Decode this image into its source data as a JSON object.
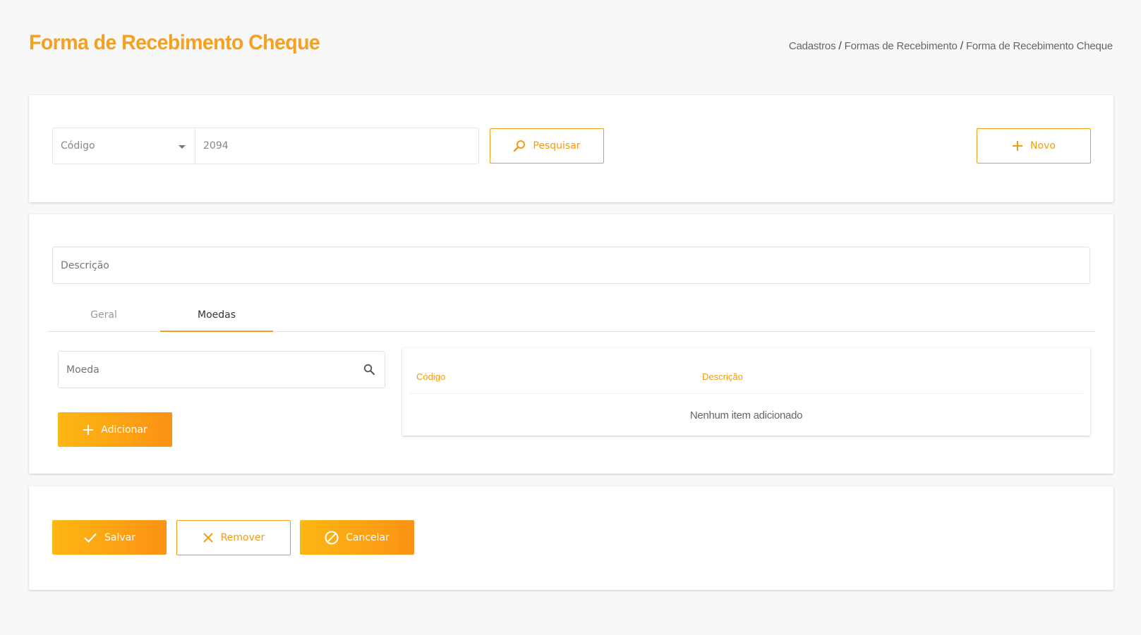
{
  "header": {
    "title": "Forma de Recebimento Cheque",
    "breadcrumb": [
      "Cadastros",
      "Formas de Recebimento",
      "Forma de Recebimento Cheque"
    ]
  },
  "search": {
    "field_select": "Código",
    "value": "2094",
    "search_label": "Pesquisar",
    "new_label": "Novo"
  },
  "form": {
    "description_placeholder": "Descrição",
    "tabs": [
      {
        "label": "Geral",
        "active": false
      },
      {
        "label": "Moedas",
        "active": true
      }
    ],
    "moeda_placeholder": "Moeda",
    "add_label": "Adicionar",
    "table": {
      "columns": [
        "Código",
        "Descrição"
      ],
      "empty_text": "Nenhum item adicionado"
    }
  },
  "actions": {
    "save_label": "Salvar",
    "remove_label": "Remover",
    "cancel_label": "Cancelar"
  },
  "colors": {
    "accent": "#f39c12",
    "title": "#f5a020"
  }
}
